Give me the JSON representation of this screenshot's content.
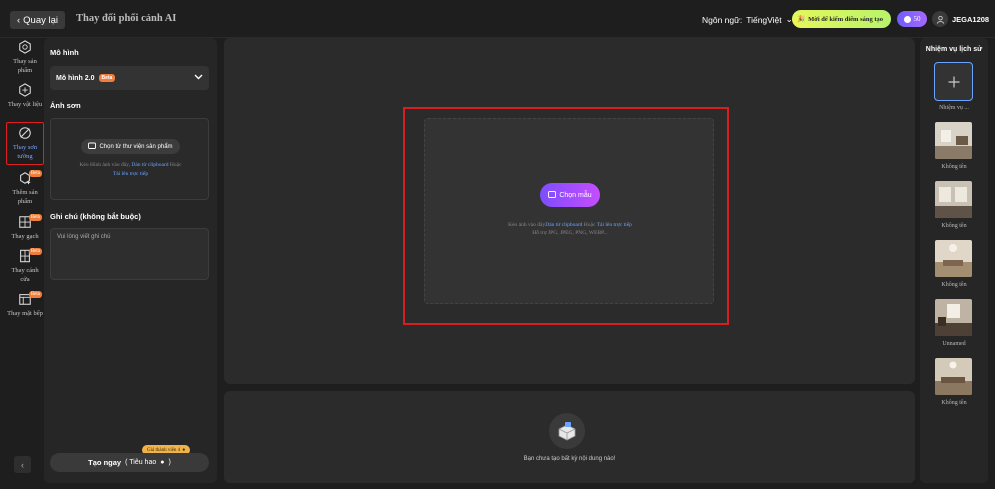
{
  "topbar": {
    "back_label": "Quay lại",
    "page_title": "Thay đổi phối cảnh AI",
    "language_label": "Ngôn ngữ:",
    "language_value": "TiếngViệt",
    "promo_label": "Mời để kiếm điểm sáng tạo",
    "credits": "50",
    "username": "JEGA1208"
  },
  "tools": [
    {
      "label": "Thay sản phẩm",
      "icon": "cube-swap-icon",
      "beta": false,
      "active": false
    },
    {
      "label": "Thay vật liệu",
      "icon": "material-swap-icon",
      "beta": false,
      "active": false
    },
    {
      "label": "Thay sơn tường",
      "icon": "paint-slash-icon",
      "beta": false,
      "active": true
    },
    {
      "label": "Thêm sản phẩm",
      "icon": "add-product-icon",
      "beta": true,
      "active": false
    },
    {
      "label": "Thay gạch",
      "icon": "tile-icon",
      "beta": true,
      "active": false
    },
    {
      "label": "Thay cánh cửa",
      "icon": "door-icon",
      "beta": true,
      "active": false
    },
    {
      "label": "Thay mặt bếp",
      "icon": "kitchen-icon",
      "beta": true,
      "active": false
    }
  ],
  "beta_label": "Beta",
  "panel": {
    "model_title": "Mô hình",
    "model_value": "Mô hình 2.0",
    "model_badge": "Beta",
    "paint_title": "Ảnh sơn",
    "library_button": "Chọn từ thư viện sản phẩm",
    "upload_hint_prefix": "Kéo Hình ảnh vào đây,",
    "upload_hint_clipboard": "Dán từ clipboard",
    "upload_hint_or": "Hoặc",
    "upload_hint_direct": "Tải lên trực tiếp",
    "notes_title": "Ghi chú (không bắt buộc)",
    "notes_placeholder": "Vui lòng viết ghi chú",
    "create_label": "Tạo ngay",
    "create_cost": "( Tiêu hao",
    "create_cost_end": ")",
    "price_tag": "Giá thành viên 4"
  },
  "canvas": {
    "sample_button": "Chọn mẫu",
    "hint_prefix": "Kéo ảnh vào đây",
    "hint_clipboard": "Dán từ clipboard",
    "hint_or": "Hoặc",
    "hint_direct": "Tải lên trực tiếp",
    "formats": "Hỗ trợ JPG, JPEG, PNG, WEBP..."
  },
  "results": {
    "empty_text": "Bạn chưa tạo bất kỳ nội dung nào!"
  },
  "history": {
    "title": "Nhiệm vụ lịch sử",
    "new_task_label": "Nhiệm vụ ...",
    "items": [
      {
        "label": "Không tên"
      },
      {
        "label": "Không tên"
      },
      {
        "label": "Không tên"
      },
      {
        "label": "Unnamed"
      },
      {
        "label": "Không tên"
      }
    ]
  },
  "colors": {
    "accent_blue": "#6aa4ff",
    "highlight_red": "#d81f1f",
    "beta_orange": "#f07d3a",
    "purple_button": "#9a4dff"
  }
}
